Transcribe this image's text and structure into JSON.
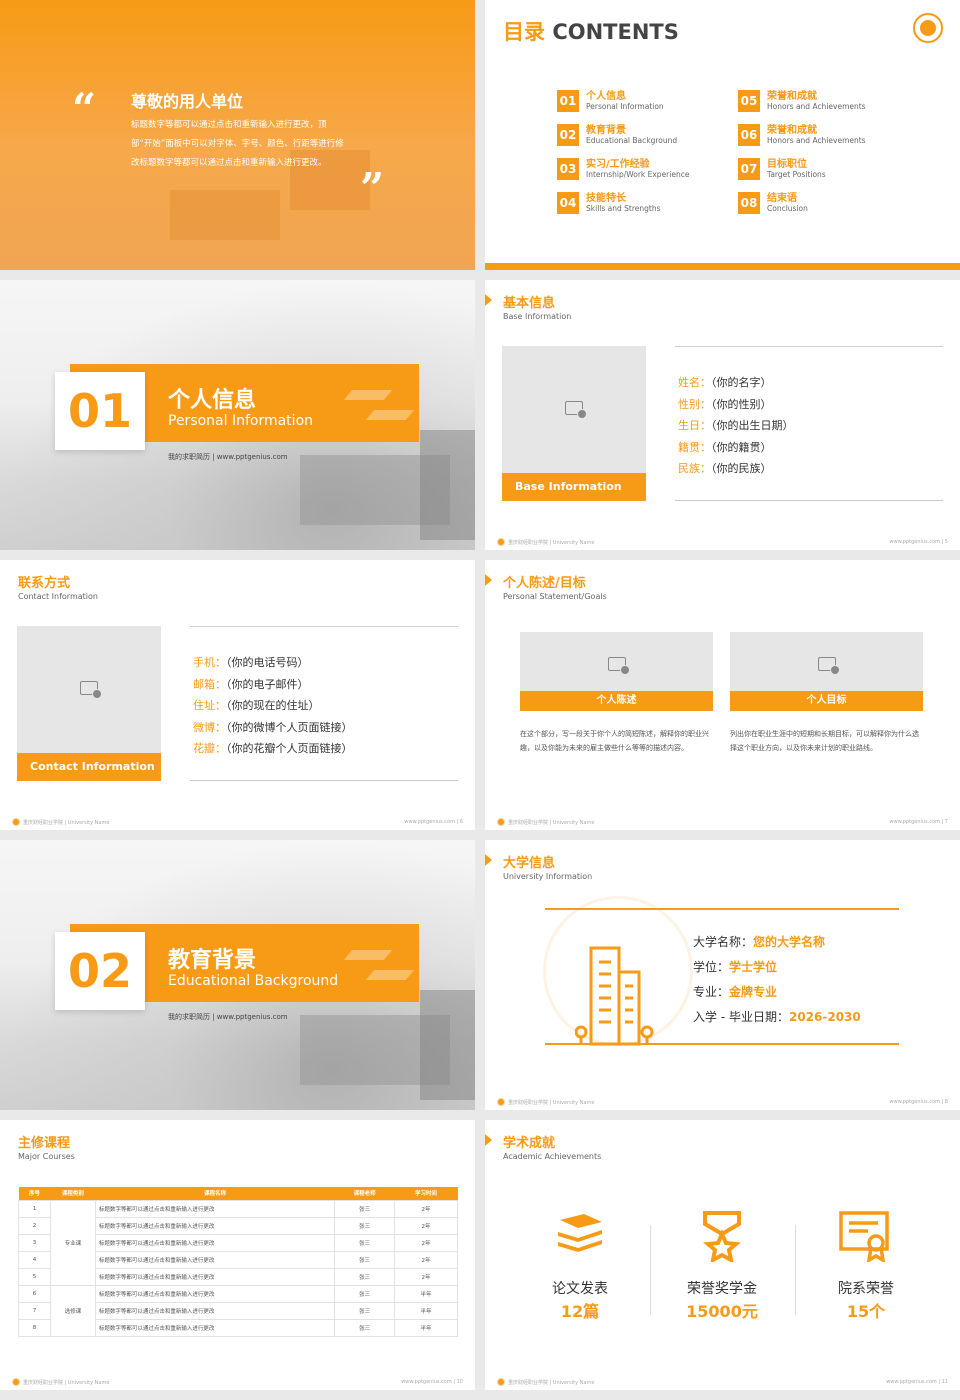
{
  "slide1": {
    "title": "尊敬的用人单位",
    "body": "标题数字等都可以通过点击和重新输入进行更改，顶部“开始”面板中可以对字体、字号、颜色、行距等进行修改标题数字等都可以通过点击和重新输入进行更改。"
  },
  "slide2": {
    "title_zh": "目录",
    "title_en": "CONTENTS",
    "items": [
      {
        "num": "01",
        "zh": "个人信息",
        "en": "Personal Information"
      },
      {
        "num": "02",
        "zh": "教育背景",
        "en": "Educational Background"
      },
      {
        "num": "03",
        "zh": "实习/工作经验",
        "en": "Internship/Work Experience"
      },
      {
        "num": "04",
        "zh": "技能特长",
        "en": "Skills and Strengths"
      },
      {
        "num": "05",
        "zh": "荣誉和成就",
        "en": "Honors and Achievements"
      },
      {
        "num": "06",
        "zh": "荣誉和成就",
        "en": "Honors and Achievements"
      },
      {
        "num": "07",
        "zh": "目标职位",
        "en": "Target Positions"
      },
      {
        "num": "08",
        "zh": "结束语",
        "en": "Conclusion"
      }
    ]
  },
  "slide3": {
    "num": "01",
    "zh": "个人信息",
    "en": "Personal Information",
    "sub": "我的求职简历 | www.pptgenius.com"
  },
  "slide4": {
    "zh": "基本信息",
    "en": "Base Information",
    "caption": "Base Information",
    "fields": [
      {
        "k": "姓名：",
        "v": "（你的名字）"
      },
      {
        "k": "性别：",
        "v": "（你的性别）"
      },
      {
        "k": "生日：",
        "v": "（你的出生日期）"
      },
      {
        "k": "籍贯：",
        "v": "（你的籍贯）"
      },
      {
        "k": "民族：",
        "v": "（你的民族）"
      }
    ],
    "footer_left": "重庆财经职业学院 | University Name",
    "footer_right": "www.pptgenius.com  |  5"
  },
  "slide5": {
    "zh": "联系方式",
    "en": "Contact Information",
    "caption": "Contact Information",
    "fields": [
      {
        "k": "手机：",
        "v": "（你的电话号码）"
      },
      {
        "k": "邮箱：",
        "v": "（你的电子邮件）"
      },
      {
        "k": "住址：",
        "v": "（你的现在的住址）"
      },
      {
        "k": "微博：",
        "v": "（你的微博个人页面链接）"
      },
      {
        "k": "花瓣：",
        "v": "（你的花瓣个人页面链接）"
      }
    ],
    "footer_left": "重庆财经职业学院 | University Name",
    "footer_right": "www.pptgenius.com  |  6"
  },
  "slide6": {
    "zh": "个人陈述/目标",
    "en": "Personal Statement/Goals",
    "cards": [
      {
        "cap": "个人陈述",
        "text": "在这个部分，写一段关于你个人的简短陈述，解释你的职业兴趣，以及你能为未来的雇主做些什么等等的描述内容。"
      },
      {
        "cap": "个人目标",
        "text": "列出你在职业生涯中的短期和长期目标，可以解释你为什么选择这个职业方向，以及你未来计划的职业路线。"
      }
    ],
    "footer_left": "重庆财经职业学院 | University Name",
    "footer_right": "www.pptgenius.com  |  7"
  },
  "slide7": {
    "num": "02",
    "zh": "教育背景",
    "en": "Educational Background",
    "sub": "我的求职简历 | www.pptgenius.com"
  },
  "slide8": {
    "zh": "大学信息",
    "en": "University Information",
    "fields": [
      {
        "k": "大学名称：",
        "v": "您的大学名称"
      },
      {
        "k": "学位：",
        "v": "学士学位"
      },
      {
        "k": "专业：",
        "v": "金牌专业"
      },
      {
        "k": "入学 - 毕业日期：",
        "v": "2026-2030"
      }
    ],
    "footer_left": "重庆财经职业学院 | University Name",
    "footer_right": "www.pptgenius.com  |  8"
  },
  "slide9": {
    "zh": "主修课程",
    "en": "Major Courses",
    "headers": [
      "序号",
      "课程类别",
      "课程名称",
      "课程老师",
      "学习时间"
    ],
    "rows": [
      {
        "no": "1",
        "name": "标题数字等都可以通过点击和重新输入进行更改",
        "teacher": "张三",
        "time": "2年"
      },
      {
        "no": "2",
        "name": "标题数字等都可以通过点击和重新输入进行更改",
        "teacher": "张三",
        "time": "2年"
      },
      {
        "no": "3",
        "name": "标题数字等都可以通过点击和重新输入进行更改",
        "teacher": "张三",
        "time": "2年"
      },
      {
        "no": "4",
        "name": "标题数字等都可以通过点击和重新输入进行更改",
        "teacher": "张三",
        "time": "2年"
      },
      {
        "no": "5",
        "name": "标题数字等都可以通过点击和重新输入进行更改",
        "teacher": "张三",
        "time": "2年"
      },
      {
        "no": "6",
        "name": "标题数字等都可以通过点击和重新输入进行更改",
        "teacher": "张三",
        "time": "半年"
      },
      {
        "no": "7",
        "name": "标题数字等都可以通过点击和重新输入进行更改",
        "teacher": "张三",
        "time": "半年"
      },
      {
        "no": "8",
        "name": "标题数字等都可以通过点击和重新输入进行更改",
        "teacher": "张三",
        "time": "半年"
      }
    ],
    "cat1": "专业课",
    "cat2": "选修课",
    "footer_left": "重庆财经职业学院 | University Name",
    "footer_right": "www.pptgenius.com  |  10"
  },
  "slide10": {
    "zh": "学术成就",
    "en": "Academic Achievements",
    "stats": [
      {
        "label": "论文发表",
        "value": "12篇"
      },
      {
        "label": "荣誉奖学金",
        "value": "15000元"
      },
      {
        "label": "院系荣誉",
        "value": "15个"
      }
    ],
    "footer_left": "重庆财经职业学院 | University Name",
    "footer_right": "www.pptgenius.com  |  11"
  }
}
